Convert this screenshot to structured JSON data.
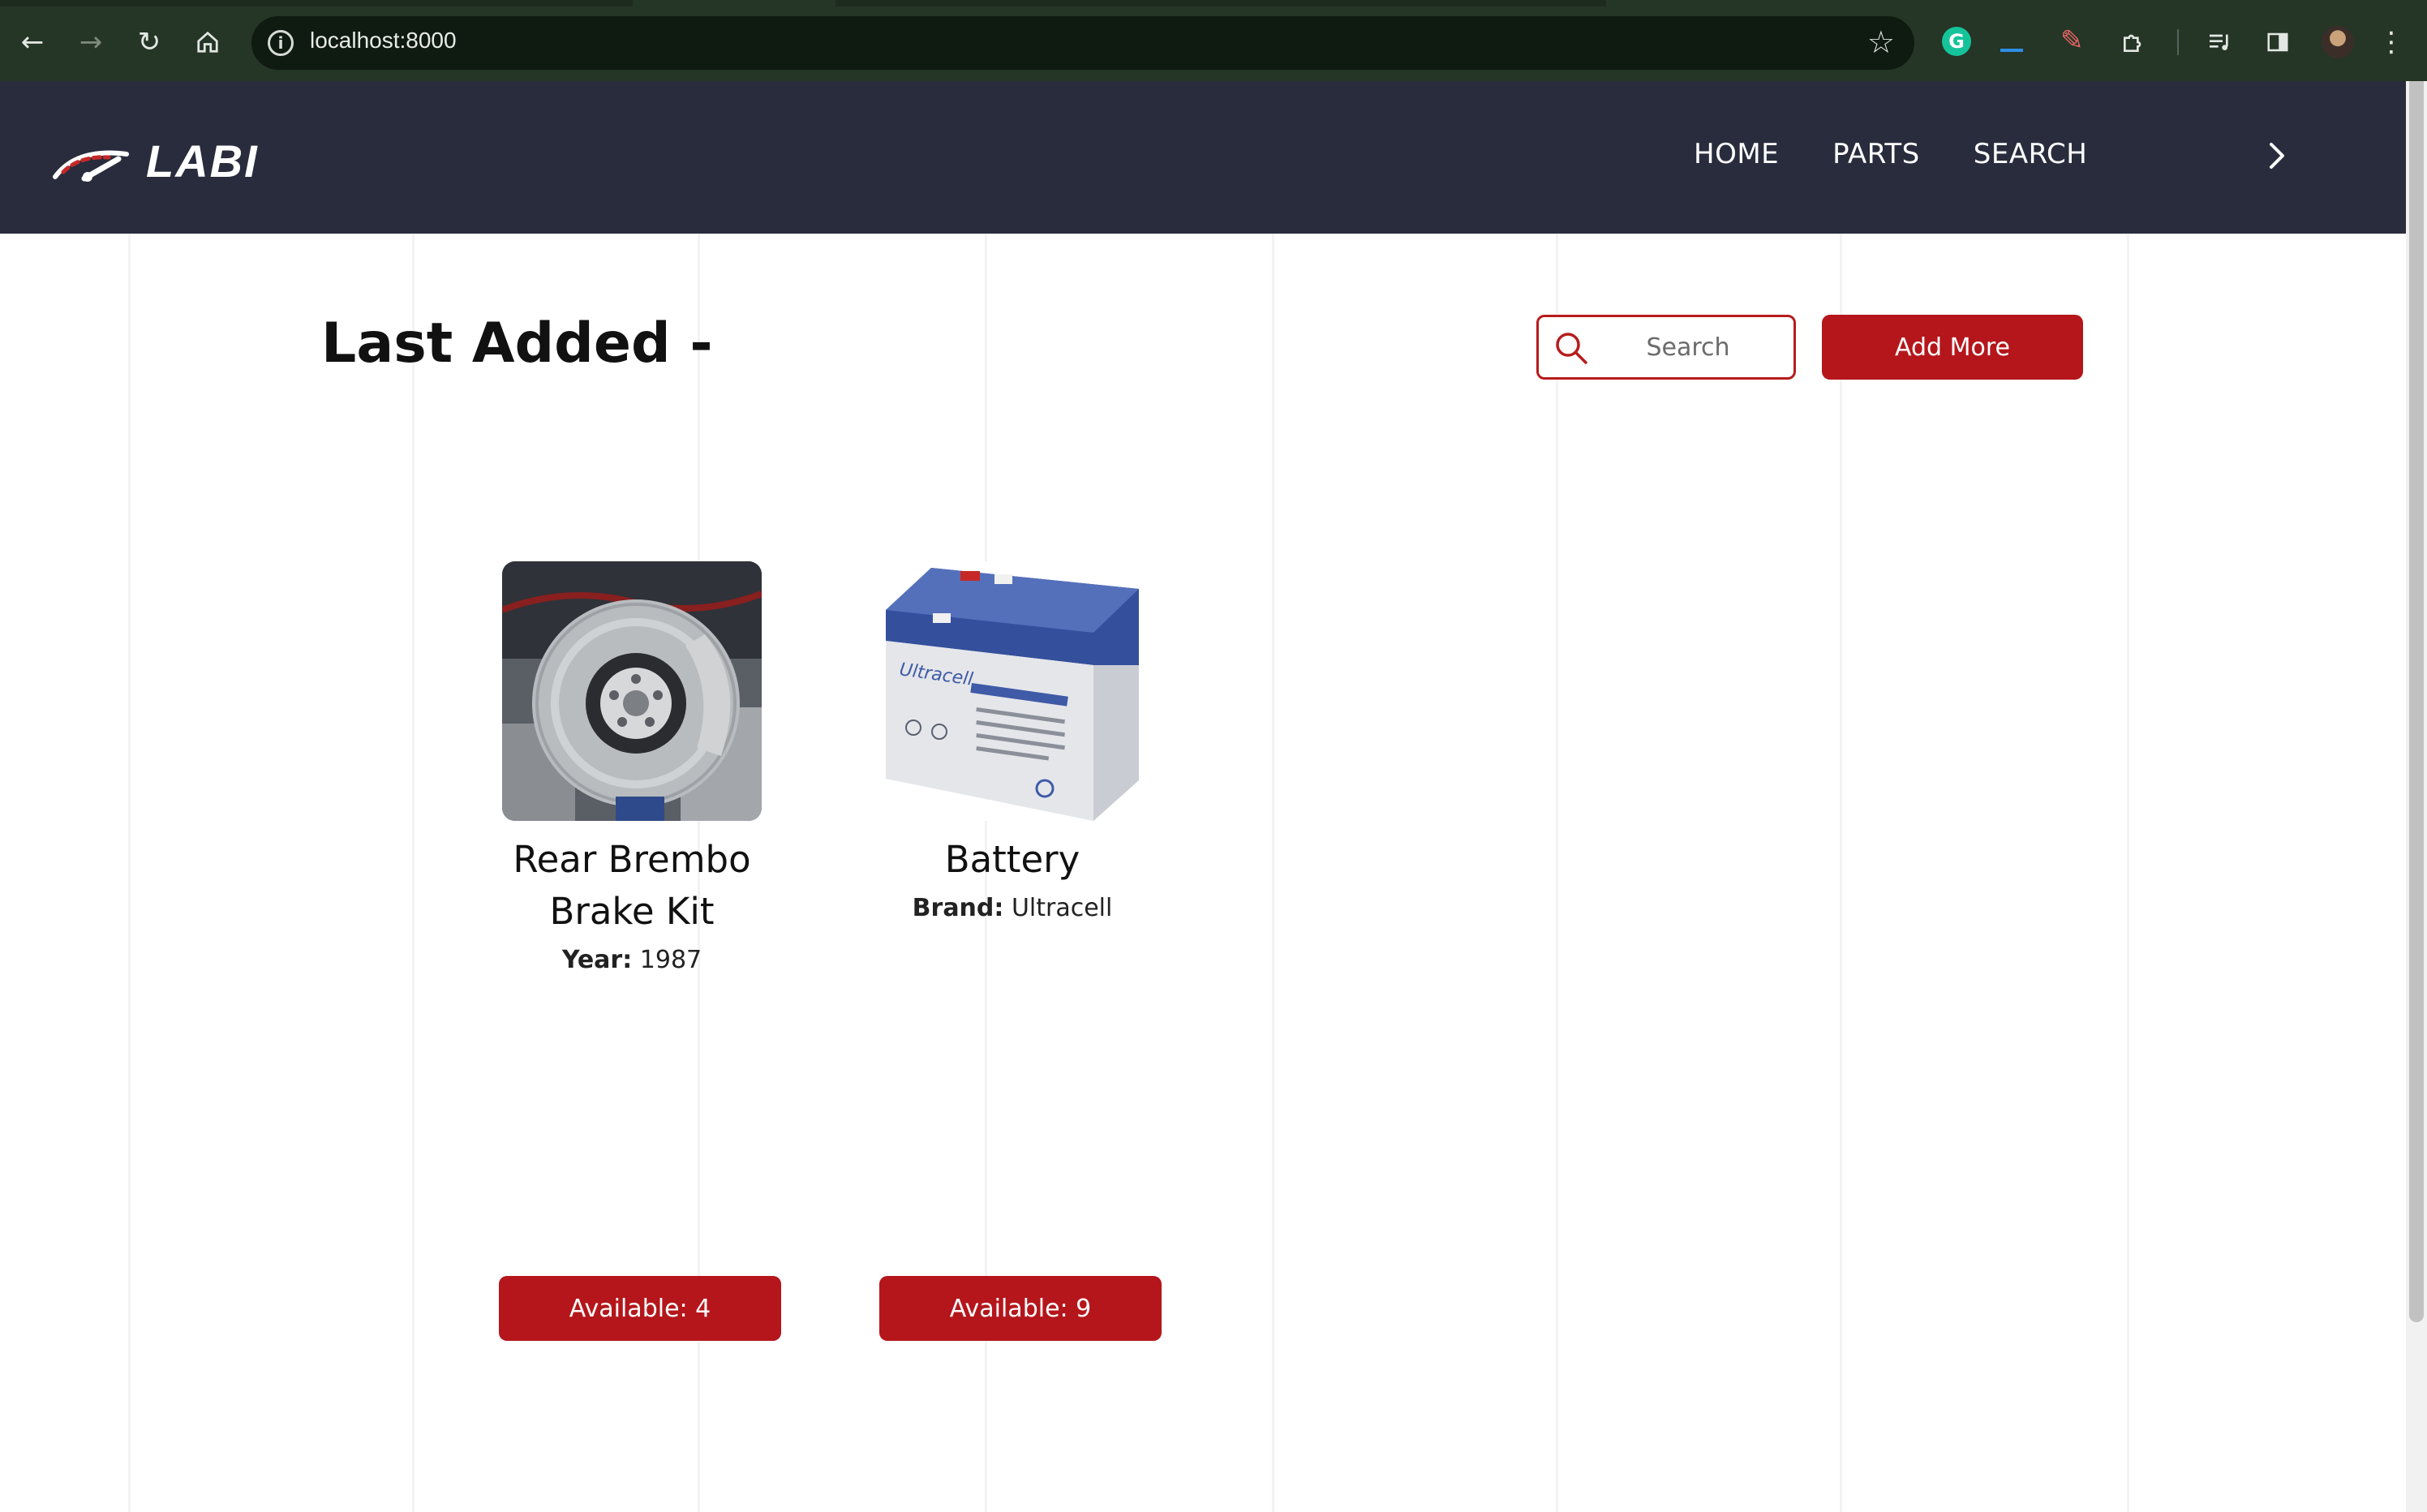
{
  "browser": {
    "url": "localhost:8000"
  },
  "header": {
    "logo_text": "LABI",
    "nav": [
      {
        "label": "HOME"
      },
      {
        "label": "PARTS"
      },
      {
        "label": "SEARCH"
      }
    ]
  },
  "main": {
    "title": "Last Added -",
    "search_placeholder": "Search",
    "add_more_label": "Add More",
    "cards": [
      {
        "name_line1": "Rear Brembo",
        "name_line2": "Brake Kit",
        "meta_label": "Year:",
        "meta_value": "1987",
        "availability": "Available: 4"
      },
      {
        "name_line1": "Battery",
        "meta_label": "Brand:",
        "meta_value": "Ultracell",
        "availability": "Available: 9",
        "product_label": "Ultracell"
      }
    ]
  },
  "colors": {
    "header_bg": "#292c3d",
    "accent_red": "#b5161b",
    "chrome_bg": "#253526"
  }
}
